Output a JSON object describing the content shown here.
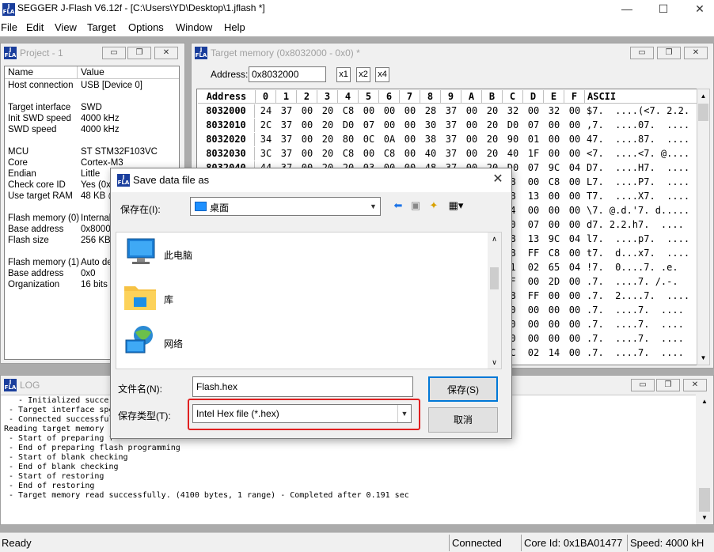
{
  "app": {
    "title": "SEGGER J-Flash V6.12f - [C:\\Users\\YD\\Desktop\\1.jflash *]",
    "logo": "J FLASH"
  },
  "menu": [
    "File",
    "Edit",
    "View",
    "Target",
    "Options",
    "Window",
    "Help"
  ],
  "project": {
    "title": "Project - 1",
    "headers": [
      "Name",
      "Value"
    ],
    "rows": [
      {
        "name": "Host connection",
        "value": "USB [Device 0]"
      },
      {
        "name": "Target interface",
        "value": "SWD"
      },
      {
        "name": "Init SWD speed",
        "value": "4000 kHz"
      },
      {
        "name": "SWD speed",
        "value": "4000 kHz"
      },
      {
        "name": "MCU",
        "value": "ST STM32F103VC"
      },
      {
        "name": "Core",
        "value": "Cortex-M3"
      },
      {
        "name": "Endian",
        "value": "Little"
      },
      {
        "name": "Check core ID",
        "value": "Yes (0x"
      },
      {
        "name": "Use target RAM",
        "value": "48 KB @"
      },
      {
        "name": "Flash memory (0)",
        "value": "Internal"
      },
      {
        "name": "Base address",
        "value": "0x8000("
      },
      {
        "name": "Flash size",
        "value": "256 KB"
      },
      {
        "name": "Flash memory (1)",
        "value": "Auto de"
      },
      {
        "name": "Base address",
        "value": "0x0"
      },
      {
        "name": "Organization",
        "value": "16 bits x"
      }
    ]
  },
  "memory": {
    "title": "Target memory (0x8032000 - 0x0) *",
    "address_label": "Address:",
    "address_value": "0x8032000",
    "zoom_buttons": [
      "x1",
      "x2",
      "x4"
    ],
    "columns": [
      "Address",
      "0",
      "1",
      "2",
      "3",
      "4",
      "5",
      "6",
      "7",
      "8",
      "9",
      "A",
      "B",
      "C",
      "D",
      "E",
      "F",
      "ASCII"
    ],
    "rows": [
      {
        "addr": "8032000",
        "bytes": [
          "24",
          "37",
          "00",
          "20",
          "C8",
          "00",
          "00",
          "00",
          "28",
          "37",
          "00",
          "20",
          "32",
          "00",
          "32",
          "00"
        ],
        "ascii": "$7.  ....(<7. 2.2."
      },
      {
        "addr": "8032010",
        "bytes": [
          "2C",
          "37",
          "00",
          "20",
          "D0",
          "07",
          "00",
          "00",
          "30",
          "37",
          "00",
          "20",
          "D0",
          "07",
          "00",
          "00"
        ],
        "ascii": ",7.  ....07.  ...."
      },
      {
        "addr": "8032020",
        "bytes": [
          "34",
          "37",
          "00",
          "20",
          "80",
          "0C",
          "0A",
          "00",
          "38",
          "37",
          "00",
          "20",
          "90",
          "01",
          "00",
          "00"
        ],
        "ascii": "47.  ....87.  ...."
      },
      {
        "addr": "8032030",
        "bytes": [
          "3C",
          "37",
          "00",
          "20",
          "C8",
          "00",
          "C8",
          "00",
          "40",
          "37",
          "00",
          "20",
          "40",
          "1F",
          "00",
          "00"
        ],
        "ascii": "<7.  ....<7. @...."
      },
      {
        "addr": "8032040",
        "bytes": [
          "44",
          "37",
          "00",
          "20",
          "20",
          "03",
          "00",
          "00",
          "48",
          "37",
          "00",
          "20",
          "D0",
          "07",
          "9C",
          "04"
        ],
        "ascii": "D7.  ....H7.  ...."
      },
      {
        "addr": "",
        "bytes": [
          "",
          "",
          "",
          "",
          "",
          "",
          "",
          "",
          "",
          "",
          "",
          "",
          "B",
          "00",
          "C8",
          "00"
        ],
        "ascii": "L7.  ....P7.  ...."
      },
      {
        "addr": "",
        "bytes": [
          "",
          "",
          "",
          "",
          "",
          "",
          "",
          "",
          "",
          "",
          "",
          "",
          "B",
          "13",
          "00",
          "00"
        ],
        "ascii": "T7.  ....X7.  ...."
      },
      {
        "addr": "",
        "bytes": [
          "",
          "",
          "",
          "",
          "",
          "",
          "",
          "",
          "",
          "",
          "",
          "",
          "4",
          "00",
          "00",
          "00"
        ],
        "ascii": "\\7. @.d.'7. d....."
      },
      {
        "addr": "",
        "bytes": [
          "",
          "",
          "",
          "",
          "",
          "",
          "",
          "",
          "",
          "",
          "",
          "",
          "0",
          "07",
          "00",
          "00"
        ],
        "ascii": "d7. 2.2.h7.  ...."
      },
      {
        "addr": "",
        "bytes": [
          "",
          "",
          "",
          "",
          "",
          "",
          "",
          "",
          "",
          "",
          "",
          "",
          "B",
          "13",
          "9C",
          "04"
        ],
        "ascii": "l7.  ....p7.  ...."
      },
      {
        "addr": "",
        "bytes": [
          "",
          "",
          "",
          "",
          "",
          "",
          "",
          "",
          "",
          "",
          "",
          "",
          "B",
          "FF",
          "C8",
          "00"
        ],
        "ascii": "t7.  d...x7.  ...."
      },
      {
        "addr": "",
        "bytes": [
          "",
          "",
          "",
          "",
          "",
          "",
          "",
          "",
          "",
          "",
          "",
          "",
          "1",
          "02",
          "65",
          "04"
        ],
        "ascii": "!7.  0....7. .e."
      },
      {
        "addr": "",
        "bytes": [
          "",
          "",
          "",
          "",
          "",
          "",
          "",
          "",
          "",
          "",
          "",
          "",
          "F",
          "00",
          "2D",
          "00"
        ],
        "ascii": ".7.  ....7. /.-."
      },
      {
        "addr": "",
        "bytes": [
          "",
          "",
          "",
          "",
          "",
          "",
          "",
          "",
          "",
          "",
          "",
          "",
          "B",
          "FF",
          "00",
          "00"
        ],
        "ascii": ".7.  2....7.  ...."
      },
      {
        "addr": "",
        "bytes": [
          "",
          "",
          "",
          "",
          "",
          "",
          "",
          "",
          "",
          "",
          "",
          "",
          "0",
          "00",
          "00",
          "00"
        ],
        "ascii": ".7.  ....7.  ...."
      },
      {
        "addr": "",
        "bytes": [
          "",
          "",
          "",
          "",
          "",
          "",
          "",
          "",
          "",
          "",
          "",
          "",
          "0",
          "00",
          "00",
          "00"
        ],
        "ascii": ".7.  ....7.  ...."
      },
      {
        "addr": "",
        "bytes": [
          "",
          "",
          "",
          "",
          "",
          "",
          "",
          "",
          "",
          "",
          "",
          "",
          "0",
          "00",
          "00",
          "00"
        ],
        "ascii": ".7.  ....7.  ...."
      },
      {
        "addr": "",
        "bytes": [
          "",
          "",
          "",
          "",
          "",
          "",
          "",
          "",
          "",
          "",
          "",
          "",
          "C",
          "02",
          "14",
          "00"
        ],
        "ascii": ".7.  ....7.  ...."
      }
    ]
  },
  "log": {
    "title": "LOG",
    "lines": [
      "   - Initialized succe",
      " - Target interface spe",
      " - Connected successful",
      "Reading target memory (",
      " - Start of preparing f",
      " - End of preparing flash programming",
      " - Start of blank checking",
      " - End of blank checking",
      " - Start of restoring",
      " - End of restoring",
      " - Target memory read successfully. (4100 bytes, 1 range) - Completed after 0.191 sec"
    ]
  },
  "status": {
    "ready": "Ready",
    "connected": "Connected",
    "core_id": "Core Id: 0x1BA01477",
    "speed": "Speed: 4000 kH"
  },
  "dialog": {
    "title": "Save data file as",
    "save_in_label": "保存在(I):",
    "save_in_value": "桌面",
    "items": [
      {
        "label": "此电脑",
        "icon": "computer-icon"
      },
      {
        "label": "库",
        "icon": "library-folder-icon"
      },
      {
        "label": "网络",
        "icon": "network-icon"
      }
    ],
    "filename_label": "文件名(N):",
    "filename_value": "Flash.hex",
    "filetype_label": "保存类型(T):",
    "filetype_value": "Intel Hex file (*.hex)",
    "save_button": "保存(S)",
    "cancel_button": "取消"
  },
  "colors": {
    "highlight_border": "#e02020",
    "logo_blue": "#1a3e9c",
    "default_button_border": "#0078d7"
  }
}
